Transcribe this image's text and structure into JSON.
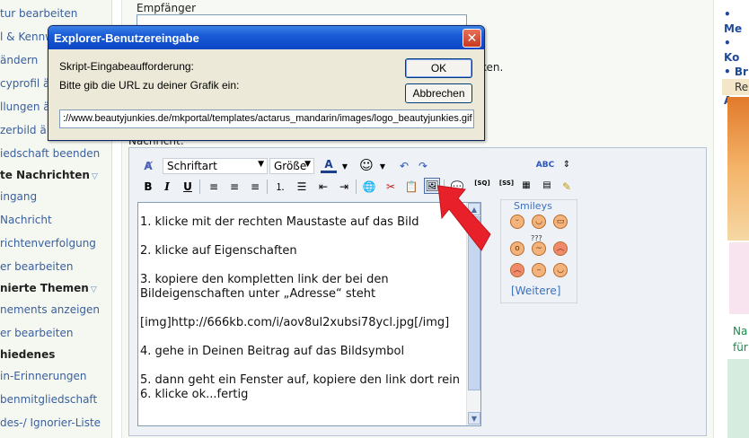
{
  "sidebar": {
    "items": [
      {
        "label": "tur bearbeiten",
        "bold": false
      },
      {
        "label": "l & Kennw",
        "bold": false
      },
      {
        "label": "ändern",
        "bold": false
      },
      {
        "label": "cyprofil än",
        "bold": false
      },
      {
        "label": "llungen ä",
        "bold": false
      },
      {
        "label": "zerbild ä",
        "bold": false
      },
      {
        "label": "iedschaft beenden",
        "bold": false
      },
      {
        "label": "te Nachrichten",
        "bold": true,
        "toggle": true
      },
      {
        "label": "ingang",
        "bold": false
      },
      {
        "label": "Nachricht",
        "bold": false
      },
      {
        "label": "richtenverfolgung",
        "bold": false
      },
      {
        "label": "er bearbeiten",
        "bold": false
      },
      {
        "label": "nierte Themen",
        "bold": true,
        "toggle": true
      },
      {
        "label": "nements anzeigen",
        "bold": false
      },
      {
        "label": "er bearbeiten",
        "bold": false
      },
      {
        "label": "hiedenes",
        "bold": true
      },
      {
        "label": "in-Erinnerungen",
        "bold": false
      },
      {
        "label": "benmitgliedschaft",
        "bold": false
      },
      {
        "label": "des-/ Ignorier-Liste",
        "bold": false
      }
    ]
  },
  "form": {
    "recipient_label": "Empfänger",
    "recipient_value": "",
    "hint_fragment": "ken.",
    "message_label": "Nachricht:"
  },
  "toolbar": {
    "font_select": "Schriftart",
    "size_select": "Größe"
  },
  "editor": {
    "text": "1. klicke mit der rechten Maustaste auf das Bild\n\n2. klicke auf Eigenschaften\n\n3. kopiere den kompletten link der bei den Bildeigenschaften unter „Adresse“ steht\n\n[img]http://666kb.com/i/aov8ul2xubsi78ycl.jpg[/img]\n\n4. gehe in Deinen Beitrag auf das Bildsymbol\n\n5. dann geht ein Fenster auf, kopiere den link dort rein\n6. klicke ok...fertig"
  },
  "smileys": {
    "title": "Smileys",
    "more_label": "[Weitere]",
    "items": [
      "smile",
      "happy",
      "grin",
      "surprised",
      "confused",
      "angry",
      "sad",
      "neutral",
      "wink"
    ]
  },
  "right_column": {
    "links": [
      "Me",
      "Ko",
      "Br",
      "Au"
    ],
    "ad_text": [
      "Na",
      "für"
    ]
  },
  "dialog": {
    "title": "Explorer-Benutzereingabe",
    "prompt_label": "Skript-Eingabeaufforderung:",
    "question": "Bitte gib die URL zu deiner Grafik ein:",
    "ok_label": "OK",
    "cancel_label": "Abbrechen",
    "url_value": "://www.beautyjunkies.de/mkportal/templates/actarus_mandarin/images/logo_beautyjunkies.gif",
    "close_glyph": "✕"
  },
  "colors": {
    "titlebar": "#1a5bd6",
    "link": "#3a5f9e",
    "arrow": "#e8202a"
  }
}
